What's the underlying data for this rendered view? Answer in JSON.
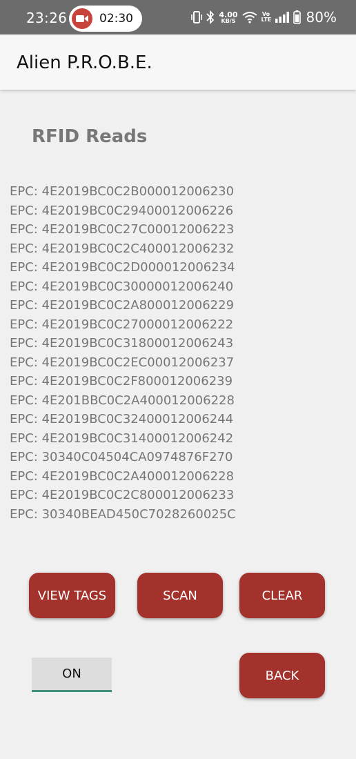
{
  "status_bar": {
    "time": "23:26",
    "recording_time": "02:30",
    "net_speed_value": "4.00",
    "net_speed_unit": "KB/S",
    "volte_label": "Vo LTE",
    "battery_percent": "80%"
  },
  "app_bar": {
    "title": "Alien P.R.O.B.E."
  },
  "main": {
    "section_title": "RFID Reads",
    "reads": [
      "EPC: 4E2019BC0C2B000012006230",
      "EPC: 4E2019BC0C29400012006226",
      "EPC: 4E2019BC0C27C00012006223",
      "EPC: 4E2019BC0C2C400012006232",
      "EPC: 4E2019BC0C2D000012006234",
      "EPC: 4E2019BC0C30000012006240",
      "EPC: 4E2019BC0C2A800012006229",
      "EPC: 4E2019BC0C27000012006222",
      "EPC: 4E2019BC0C31800012006243",
      "EPC: 4E2019BC0C2EC00012006237",
      "EPC: 4E2019BC0C2F800012006239",
      "EPC: 4E201BBC0C2A400012006228",
      "EPC: 4E2019BC0C32400012006244",
      "EPC: 4E2019BC0C31400012006242",
      "EPC: 30340C04504CA0974876F270",
      "EPC: 4E2019BC0C2A400012006228",
      "EPC: 4E2019BC0C2C800012006233",
      "EPC: 30340BEAD450C7028260025C"
    ]
  },
  "buttons": {
    "view_tags": "VIEW TAGS",
    "scan": "SCAN",
    "clear": "CLEAR",
    "toggle": "ON",
    "back": "BACK"
  },
  "colors": {
    "accent": "#a3312c",
    "toggle_underline": "#3f8f7d",
    "status_bar": "#6c6c6c",
    "text_muted": "#777777"
  },
  "icons": {
    "recording": "video-camera-icon",
    "vibrate": "vibrate-icon",
    "bluetooth": "bluetooth-icon",
    "wifi": "wifi-icon",
    "signal": "signal-icon",
    "battery": "battery-icon"
  }
}
